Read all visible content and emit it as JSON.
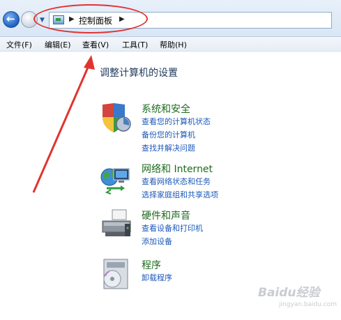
{
  "address_bar": {
    "breadcrumb": "控制面板"
  },
  "menu": [
    "文件(F)",
    "编辑(E)",
    "查看(V)",
    "工具(T)",
    "帮助(H)"
  ],
  "page_title": "调整计算机的设置",
  "categories": [
    {
      "title": "系统和安全",
      "icon": "shield-system-icon",
      "links": [
        "查看您的计算机状态",
        "备份您的计算机",
        "查找并解决问题"
      ]
    },
    {
      "title": "网络和 Internet",
      "icon": "network-globe-icon",
      "links": [
        "查看网络状态和任务",
        "选择家庭组和共享选项"
      ]
    },
    {
      "title": "硬件和声音",
      "icon": "printer-icon",
      "links": [
        "查看设备和打印机",
        "添加设备"
      ]
    },
    {
      "title": "程序",
      "icon": "programs-icon",
      "links": [
        "卸载程序"
      ]
    }
  ],
  "watermark": {
    "brand": "Baidu经验",
    "url": "jingyan.baidu.com"
  },
  "annotation_color": "#e0342f"
}
